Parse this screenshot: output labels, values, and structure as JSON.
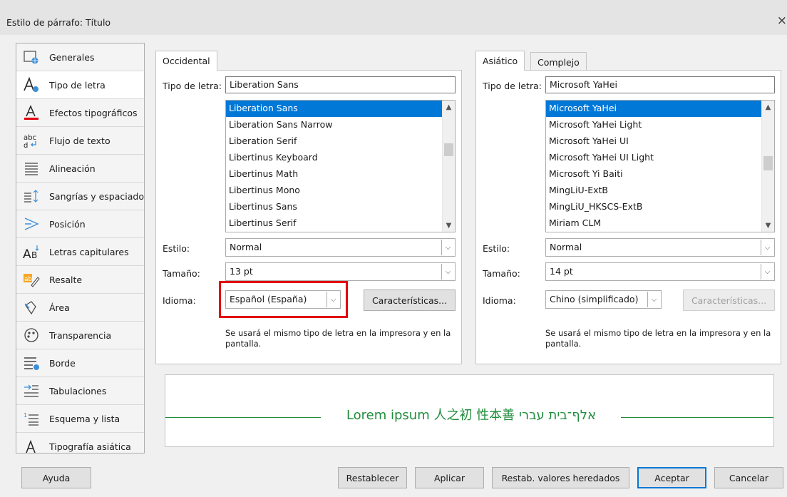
{
  "window": {
    "title": "Estilo de párrafo: Título",
    "close_icon": "×"
  },
  "sidebar": {
    "items": [
      {
        "label": "Generales",
        "icon": "general-icon"
      },
      {
        "label": "Tipo de letra",
        "icon": "font-icon"
      },
      {
        "label": "Efectos tipográficos",
        "icon": "font-effects-icon"
      },
      {
        "label": "Flujo de texto",
        "icon": "text-flow-icon"
      },
      {
        "label": "Alineación",
        "icon": "alignment-icon"
      },
      {
        "label": "Sangrías y espaciado",
        "icon": "indent-spacing-icon"
      },
      {
        "label": "Posición",
        "icon": "position-icon"
      },
      {
        "label": "Letras capitulares",
        "icon": "drop-caps-icon"
      },
      {
        "label": "Resalte",
        "icon": "highlight-icon"
      },
      {
        "label": "Área",
        "icon": "area-icon"
      },
      {
        "label": "Transparencia",
        "icon": "transparency-icon"
      },
      {
        "label": "Borde",
        "icon": "border-icon"
      },
      {
        "label": "Tabulaciones",
        "icon": "tabs-icon"
      },
      {
        "label": "Esquema y lista",
        "icon": "outline-list-icon"
      },
      {
        "label": "Tipografía asiática",
        "icon": "asian-typography-icon"
      }
    ],
    "selected_index": 1
  },
  "western": {
    "tab": "Occidental",
    "font_label": "Tipo de letra:",
    "font_value": "Liberation Sans",
    "font_list": [
      "Liberation Sans",
      "Liberation Sans Narrow",
      "Liberation Serif",
      "Libertinus Keyboard",
      "Libertinus Math",
      "Libertinus Mono",
      "Libertinus Sans",
      "Libertinus Serif"
    ],
    "style_label": "Estilo:",
    "style_value": "Normal",
    "size_label": "Tamaño:",
    "size_value": "13 pt",
    "language_label": "Idioma:",
    "language_value": "Español (España)",
    "features_button": "Características...",
    "note": "Se usará el mismo tipo de letra en la impresora y en la pantalla."
  },
  "asian": {
    "tab_asian": "Asiático",
    "tab_complex": "Complejo",
    "font_label": "Tipo de letra:",
    "font_value": "Microsoft YaHei",
    "font_list": [
      "Microsoft YaHei",
      "Microsoft YaHei Light",
      "Microsoft YaHei UI",
      "Microsoft YaHei UI Light",
      "Microsoft Yi Baiti",
      "MingLiU-ExtB",
      "MingLiU_HKSCS-ExtB",
      "Miriam CLM"
    ],
    "style_label": "Estilo:",
    "style_value": "Normal",
    "size_label": "Tamaño:",
    "size_value": "14 pt",
    "language_label": "Idioma:",
    "language_value": "Chino (simplificado)",
    "features_button": "Características...",
    "note": "Se usará el mismo tipo de letra en la impresora y en la pantalla."
  },
  "preview": {
    "text": "Lorem ipsum  人之初 性本善  אלף־בית עברי",
    "color": "#1f8c3c"
  },
  "buttons": {
    "help": "Ayuda",
    "reset": "Restablecer",
    "apply": "Aplicar",
    "reset_inherited": "Restab. valores heredados",
    "ok": "Aceptar",
    "cancel": "Cancelar"
  },
  "colors": {
    "selection": "#0078d7",
    "highlight_box": "#e3000f",
    "font_effects_underline": "#e3000f"
  }
}
